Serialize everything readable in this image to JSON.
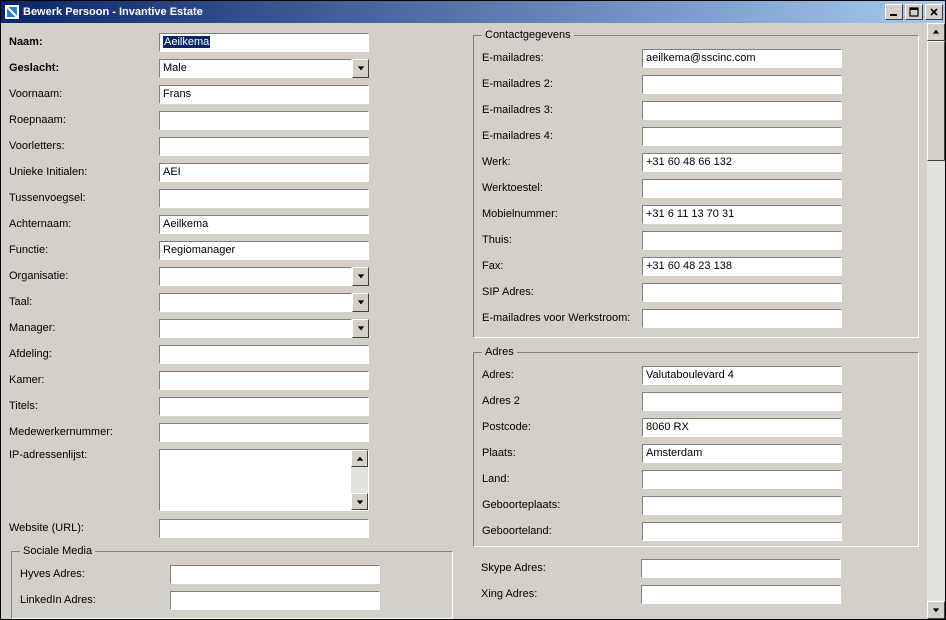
{
  "window": {
    "title": "Bewerk Persoon - Invantive Estate"
  },
  "left": {
    "naam": {
      "label": "Naam:",
      "value": "Aeilkema"
    },
    "geslacht": {
      "label": "Geslacht:",
      "value": "Male"
    },
    "voornaam": {
      "label": "Voornaam:",
      "value": "Frans"
    },
    "roepnaam": {
      "label": "Roepnaam:",
      "value": ""
    },
    "voorletters": {
      "label": "Voorletters:",
      "value": ""
    },
    "initialen": {
      "label": "Unieke Initialen:",
      "value": "AEI"
    },
    "tussenvoegsel": {
      "label": "Tussenvoegsel:",
      "value": ""
    },
    "achternaam": {
      "label": "Achternaam:",
      "value": "Aeilkema"
    },
    "functie": {
      "label": "Functie:",
      "value": "Regiomanager"
    },
    "organisatie": {
      "label": "Organisatie:",
      "value": ""
    },
    "taal": {
      "label": "Taal:",
      "value": ""
    },
    "manager": {
      "label": "Manager:",
      "value": ""
    },
    "afdeling": {
      "label": "Afdeling:",
      "value": ""
    },
    "kamer": {
      "label": "Kamer:",
      "value": ""
    },
    "titels": {
      "label": "Titels:",
      "value": ""
    },
    "medewerkernr": {
      "label": "Medewerkernummer:",
      "value": ""
    },
    "ipadressen": {
      "label": "IP-adressenlijst:",
      "value": ""
    },
    "website": {
      "label": "Website (URL):",
      "value": ""
    }
  },
  "contact": {
    "legend": "Contactgegevens",
    "email1": {
      "label": "E-mailadres:",
      "value": "aeilkema@sscinc.com"
    },
    "email2": {
      "label": "E-mailadres 2:",
      "value": ""
    },
    "email3": {
      "label": "E-mailadres 3:",
      "value": ""
    },
    "email4": {
      "label": "E-mailadres 4:",
      "value": ""
    },
    "werk": {
      "label": "Werk:",
      "value": "+31 60 48 66 132"
    },
    "werktoestel": {
      "label": "Werktoestel:",
      "value": ""
    },
    "mobiel": {
      "label": "Mobielnummer:",
      "value": "+31 6 11 13 70 31"
    },
    "thuis": {
      "label": "Thuis:",
      "value": ""
    },
    "fax": {
      "label": "Fax:",
      "value": "+31 60 48 23 138"
    },
    "sip": {
      "label": "SIP Adres:",
      "value": ""
    },
    "emailwerkstroom": {
      "label": "E-mailadres voor Werkstroom:",
      "value": ""
    }
  },
  "adres": {
    "legend": "Adres",
    "adres1": {
      "label": "Adres:",
      "value": "Valutaboulevard 4"
    },
    "adres2": {
      "label": "Adres 2",
      "value": ""
    },
    "postcode": {
      "label": "Postcode:",
      "value": "8060 RX"
    },
    "plaats": {
      "label": "Plaats:",
      "value": "Amsterdam"
    },
    "land": {
      "label": "Land:",
      "value": ""
    },
    "geboorteplaats": {
      "label": "Geboorteplaats:",
      "value": ""
    },
    "geboorteland": {
      "label": "Geboorteland:",
      "value": ""
    }
  },
  "sociale": {
    "legend": "Sociale Media",
    "hyves": {
      "label": "Hyves Adres:",
      "value": ""
    },
    "linkedin": {
      "label": "LinkedIn Adres:",
      "value": ""
    },
    "skype": {
      "label": "Skype Adres:",
      "value": ""
    },
    "xing": {
      "label": "Xing Adres:",
      "value": ""
    }
  }
}
